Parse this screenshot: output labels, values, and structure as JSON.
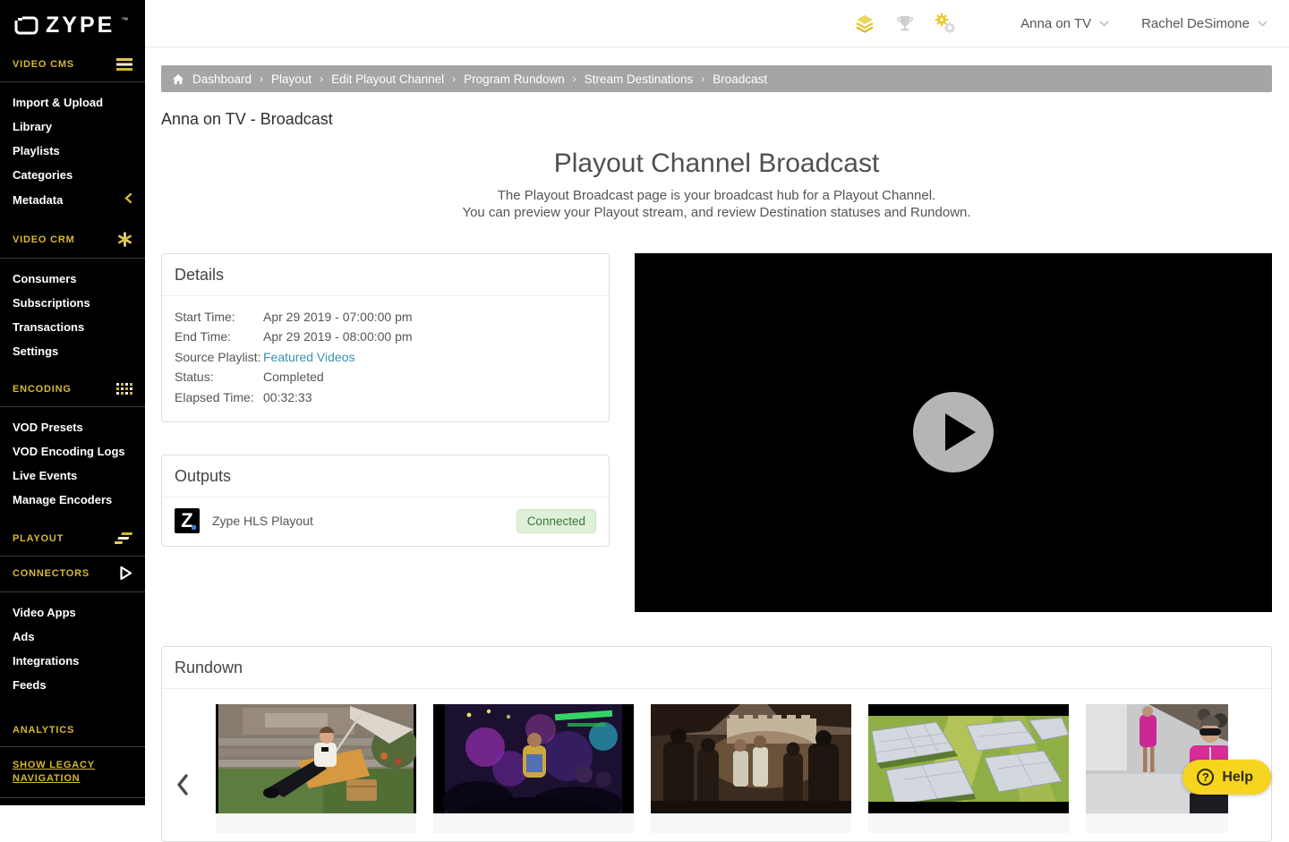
{
  "brand": {
    "logo_text": "ZYPE",
    "trademark": "™"
  },
  "topbar": {
    "icons": [
      "layers-icon",
      "trophy-icon",
      "gears-icon"
    ],
    "site_name": "Anna on TV",
    "user_name": "Rachel DeSimone"
  },
  "sidebar": {
    "sections": [
      {
        "label": "VIDEO CMS",
        "icon": "menu-icon",
        "items": [
          "Import & Upload",
          "Library",
          "Playlists",
          "Categories",
          "Metadata"
        ]
      },
      {
        "label": "VIDEO CRM",
        "icon": "asterisk-icon",
        "items": [
          "Consumers",
          "Subscriptions",
          "Transactions",
          "Settings"
        ]
      },
      {
        "label": "ENCODING",
        "icon": "grid-icon",
        "items": [
          "VOD Presets",
          "VOD Encoding Logs",
          "Live Events",
          "Manage Encoders"
        ]
      },
      {
        "label": "PLAYOUT",
        "icon": "steps-icon",
        "items": []
      },
      {
        "label": "CONNECTORS",
        "icon": "play-outline-icon",
        "items": [
          "Video Apps",
          "Ads",
          "Integrations",
          "Feeds"
        ]
      },
      {
        "label": "ANALYTICS",
        "items": []
      },
      {
        "label": "SHOW LEGACY NAVIGATION",
        "items": []
      }
    ]
  },
  "breadcrumb": {
    "items": [
      "Dashboard",
      "Playout",
      "Edit Playout Channel",
      "Program Rundown",
      "Stream Destinations",
      "Broadcast"
    ],
    "separator": "›"
  },
  "page": {
    "title": "Anna on TV - Broadcast",
    "heading": "Playout Channel Broadcast",
    "description_line1": "The Playout Broadcast page is your broadcast hub for a Playout Channel.",
    "description_line2": "You can preview your Playout stream, and review Destination statuses and Rundown."
  },
  "details": {
    "title": "Details",
    "rows": [
      {
        "label": "Start Time:",
        "value": "Apr 29 2019 - 07:00:00 pm"
      },
      {
        "label": "End Time:",
        "value": "Apr 29 2019 - 08:00:00 pm"
      },
      {
        "label": "Source Playlist:",
        "value": "Featured Videos"
      },
      {
        "label": "Status:",
        "value": "Completed"
      },
      {
        "label": "Elapsed Time:",
        "value": "00:32:33"
      }
    ]
  },
  "outputs": {
    "title": "Outputs",
    "logo_letter": "Z",
    "name": "Zype HLS Playout",
    "status": "Connected"
  },
  "rundown": {
    "title": "Rundown",
    "thumbnail_count": 5
  },
  "help": {
    "icon": "?",
    "label": "Help"
  },
  "colors": {
    "accent_gold": "#d6b832",
    "help_yellow": "#f5d51d",
    "link_blue": "#3a91b4",
    "status_connected_bg": "#dff0d8",
    "status_connected_text": "#3c763d",
    "breadcrumb_bg": "#a5a5a5",
    "sidebar_bg": "#000000"
  }
}
